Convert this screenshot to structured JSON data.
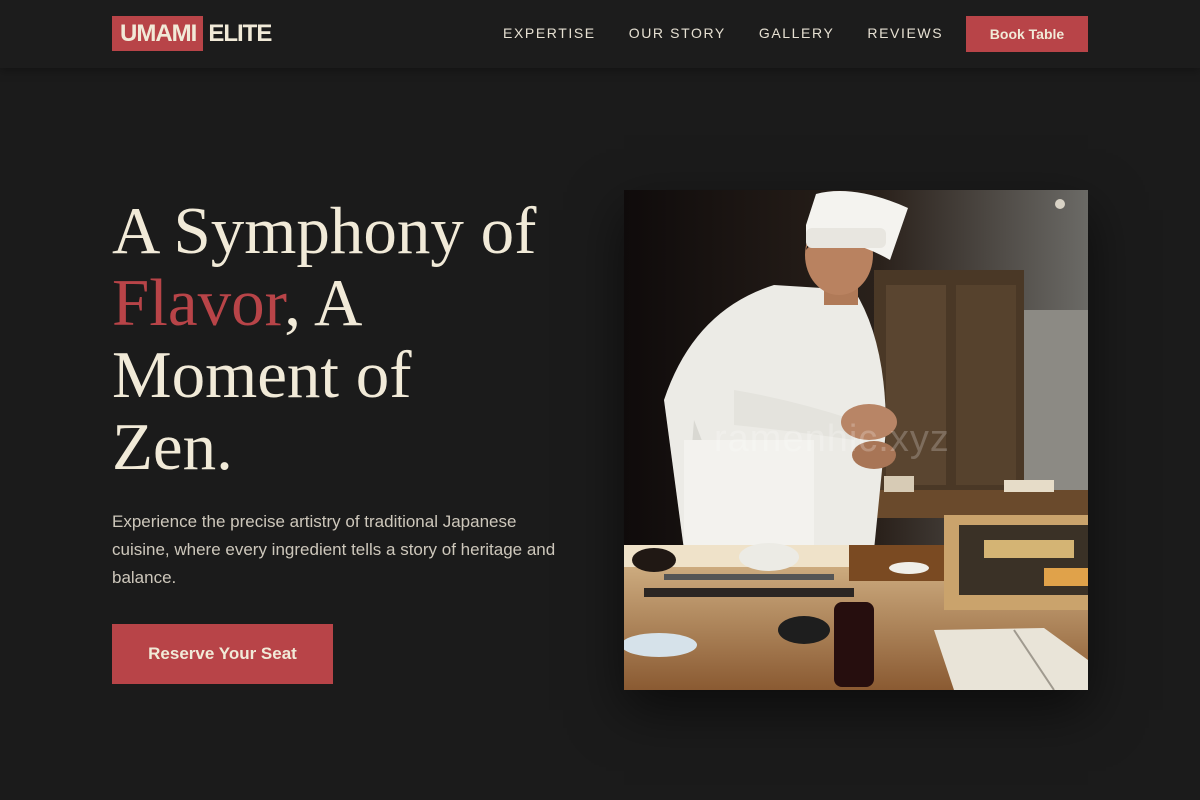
{
  "brand": {
    "logo_box": "UMAMI",
    "logo_rest": "ELITE"
  },
  "nav": {
    "links": [
      "EXPERTISE",
      "OUR STORY",
      "GALLERY",
      "REVIEWS"
    ],
    "book_label": "Book Table"
  },
  "hero": {
    "headline_line1": "A Symphony of",
    "headline_accent": "Flavor",
    "headline_after_accent": ", A",
    "headline_line3": "Moment of",
    "headline_line4": "Zen.",
    "lede": "Experience the precise artistry of traditional Japanese cuisine, where every ingredient tells a story of heritage and balance.",
    "cta_label": "Reserve Your Seat",
    "image_watermark": "ramenhic.xyz"
  },
  "colors": {
    "background": "#1b1b1b",
    "accent": "#b84448",
    "cream": "#f1ead8"
  }
}
